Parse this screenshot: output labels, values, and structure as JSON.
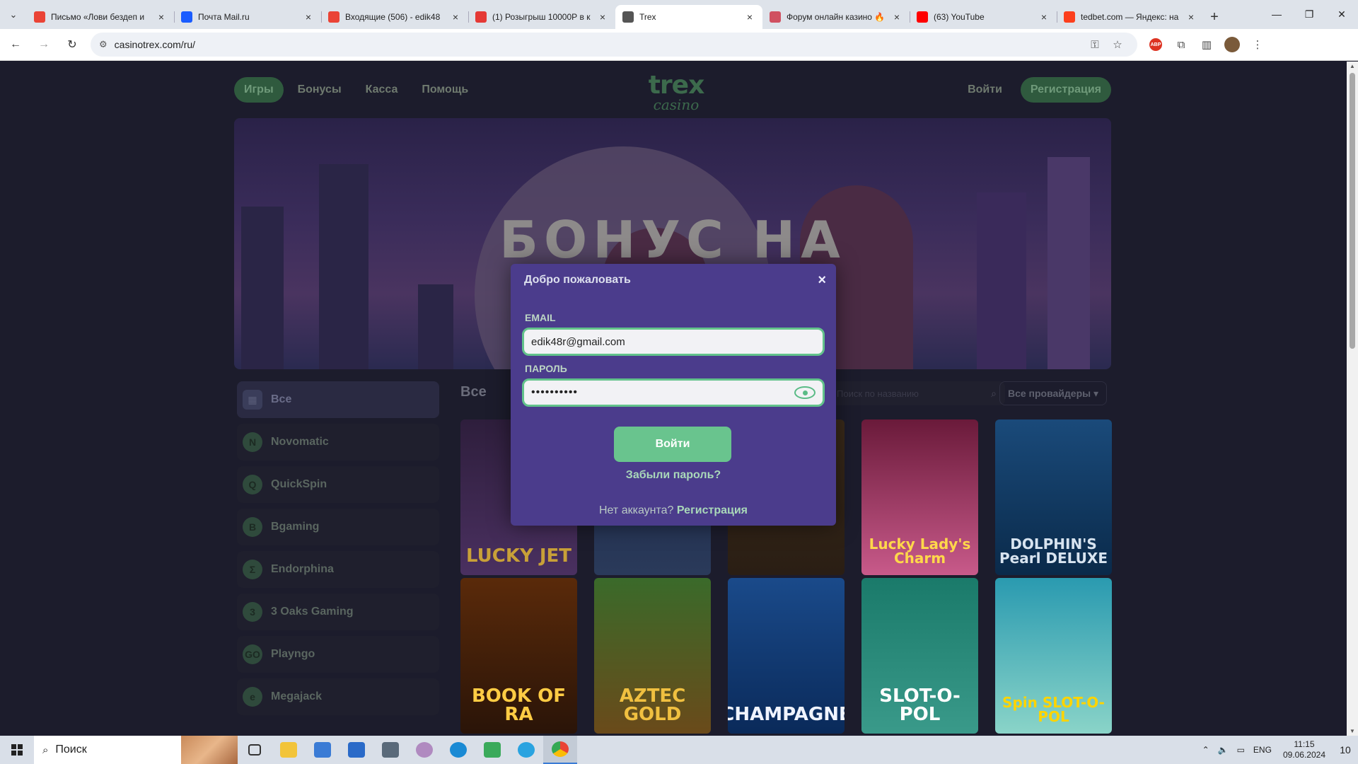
{
  "browser": {
    "tabs": [
      {
        "title": "Письмо «Лови бездеп и",
        "favicon_color": "#ea4335",
        "icon": "gmail-icon"
      },
      {
        "title": "Почта Mail.ru",
        "favicon_color": "#1a5cff",
        "icon": "mail-ru-icon"
      },
      {
        "title": "Входящие (506) - edik48",
        "favicon_color": "#ea4335",
        "icon": "gmail-icon"
      },
      {
        "title": "(1) Розыгрыш 10000Р в к",
        "favicon_color": "#e53935",
        "icon": "forum-icon"
      },
      {
        "title": "Trex",
        "favicon_color": "#555555",
        "icon": "globe-icon"
      },
      {
        "title": "Форум онлайн казино 🔥",
        "favicon_color": "#d05060",
        "icon": "forum-icon"
      },
      {
        "title": "(63) YouTube",
        "favicon_color": "#ff0000",
        "icon": "youtube-icon"
      },
      {
        "title": "tedbet.com — Яндекс: на",
        "favicon_color": "#fc3f1d",
        "icon": "yandex-icon"
      }
    ],
    "active_tab": 4,
    "url": "casinotrex.com/ru/"
  },
  "site": {
    "nav": [
      "Игры",
      "Бонусы",
      "Касса",
      "Помощь"
    ],
    "logo_top": "trex",
    "logo_bottom": "casino",
    "login_label": "Войти",
    "register_label": "Регистрация",
    "banner_headline": "БОНУС НА ДЕПОЗИТ",
    "games_title": "Все",
    "search_placeholder": "Поиск по названию",
    "providers_label": "Все провайдеры ▾",
    "sidebar": [
      {
        "label": "Все",
        "icon": "grid-icon",
        "glyph": "▦"
      },
      {
        "label": "Novomatic",
        "icon": "novomatic-icon",
        "glyph": "N"
      },
      {
        "label": "QuickSpin",
        "icon": "quickspin-icon",
        "glyph": "Q"
      },
      {
        "label": "Bgaming",
        "icon": "bgaming-icon",
        "glyph": "B"
      },
      {
        "label": "Endorphina",
        "icon": "endorphina-icon",
        "glyph": "Σ"
      },
      {
        "label": "3 Oaks Gaming",
        "icon": "oaks-icon",
        "glyph": "3"
      },
      {
        "label": "Playngo",
        "icon": "playngo-icon",
        "glyph": "GO"
      },
      {
        "label": "Megajack",
        "icon": "megajack-icon",
        "glyph": "e"
      }
    ],
    "games": [
      {
        "name": "LUCKY JET",
        "bg1": "#2e1e3c",
        "bg2": "#4a3060",
        "color": "#c8a038"
      },
      {
        "name": "",
        "bg1": "#1e2a4a",
        "bg2": "#2a3a5a",
        "color": "#888"
      },
      {
        "name": "",
        "bg1": "#3a2a1a",
        "bg2": "#2a1e14",
        "color": "#888"
      },
      {
        "name": "Lucky Lady's Charm",
        "bg1": "#6a1a3a",
        "bg2": "#c85a8a",
        "color": "#ffd84a"
      },
      {
        "name": "DOLPHIN'S Pearl DELUXE",
        "bg1": "#1a4a7a",
        "bg2": "#0a2a4a",
        "color": "#d8e4f0"
      },
      {
        "name": "BOOK OF RA",
        "bg1": "#5a2a0a",
        "bg2": "#2a1408",
        "color": "#ffcc44"
      },
      {
        "name": "AZTEC GOLD",
        "bg1": "#3a6a2a",
        "bg2": "#6a4a1a",
        "color": "#f0c040"
      },
      {
        "name": "CHAMPAGNE",
        "bg1": "#1a4a8a",
        "bg2": "#0a2a5a",
        "color": "#f0f4ff"
      },
      {
        "name": "SLOT-O-POL",
        "bg1": "#1a7a6a",
        "bg2": "#3a9a8a",
        "color": "#ffffff"
      },
      {
        "name": "Spin SLOT-O-POL",
        "bg1": "#2a9ab0",
        "bg2": "#8ad4c8",
        "color": "#ffd400"
      }
    ]
  },
  "modal": {
    "title": "Добро пожаловать",
    "close": "×",
    "email_label": "EMAIL",
    "email_value": "edik48r@gmail.com",
    "password_label": "ПАРОЛЬ",
    "password_value": "••••••••••",
    "submit": "Войти",
    "forgot": "Забыли пароль?",
    "no_account": "Нет аккаунта?",
    "register_link": "Регистрация"
  },
  "taskbar": {
    "search_label": "Поиск",
    "lang": "ENG",
    "time": "11:15",
    "date": "09.06.2024",
    "notifications": "10"
  }
}
